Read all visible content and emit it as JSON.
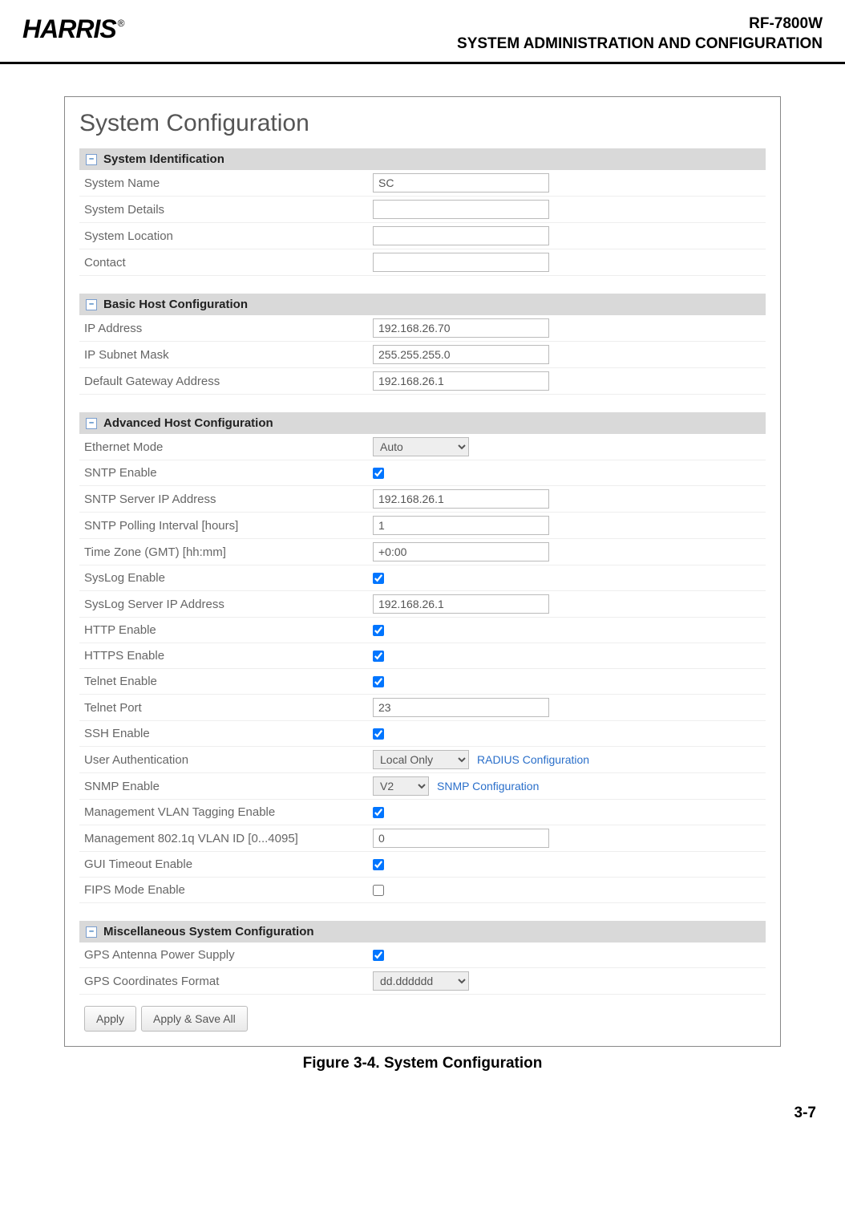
{
  "header": {
    "logo": "HARRIS",
    "reg": "®",
    "line1": "RF-7800W",
    "line2": "SYSTEM ADMINISTRATION AND CONFIGURATION"
  },
  "page_title": "System Configuration",
  "sections": {
    "sys_id": {
      "title": "System Identification",
      "collapse": "–",
      "rows": {
        "system_name": {
          "label": "System Name",
          "value": "SC"
        },
        "system_details": {
          "label": "System Details",
          "value": ""
        },
        "system_location": {
          "label": "System Location",
          "value": ""
        },
        "contact": {
          "label": "Contact",
          "value": ""
        }
      }
    },
    "basic_host": {
      "title": "Basic Host Configuration",
      "collapse": "–",
      "rows": {
        "ip_address": {
          "label": "IP Address",
          "value": "192.168.26.70"
        },
        "subnet_mask": {
          "label": "IP Subnet Mask",
          "value": "255.255.255.0"
        },
        "gateway": {
          "label": "Default Gateway Address",
          "value": "192.168.26.1"
        }
      }
    },
    "adv_host": {
      "title": "Advanced Host Configuration",
      "collapse": "–",
      "rows": {
        "eth_mode": {
          "label": "Ethernet Mode",
          "value": "Auto"
        },
        "sntp_enable": {
          "label": "SNTP Enable",
          "checked": true
        },
        "sntp_server": {
          "label": "SNTP Server IP Address",
          "value": "192.168.26.1"
        },
        "sntp_poll": {
          "label": "SNTP Polling Interval [hours]",
          "value": "1"
        },
        "timezone": {
          "label": "Time Zone (GMT)  [hh:mm]",
          "value": "+0:00"
        },
        "syslog_enable": {
          "label": "SysLog Enable",
          "checked": true
        },
        "syslog_server": {
          "label": "SysLog Server IP Address",
          "value": "192.168.26.1"
        },
        "http_enable": {
          "label": "HTTP Enable",
          "checked": true
        },
        "https_enable": {
          "label": "HTTPS Enable",
          "checked": true
        },
        "telnet_enable": {
          "label": "Telnet Enable",
          "checked": true
        },
        "telnet_port": {
          "label": "Telnet Port",
          "value": "23"
        },
        "ssh_enable": {
          "label": "SSH Enable",
          "checked": true
        },
        "user_auth": {
          "label": "User Authentication",
          "value": "Local Only",
          "link": "RADIUS Configuration"
        },
        "snmp_enable": {
          "label": "SNMP Enable",
          "value": "V2",
          "link": "SNMP Configuration"
        },
        "vlan_tag": {
          "label": "Management VLAN Tagging Enable",
          "checked": true
        },
        "vlan_id": {
          "label": "Management 802.1q VLAN ID [0...4095]",
          "value": "0"
        },
        "gui_timeout": {
          "label": "GUI Timeout Enable",
          "checked": true
        },
        "fips_mode": {
          "label": "FIPS Mode Enable",
          "checked": false
        }
      }
    },
    "misc": {
      "title": "Miscellaneous System Configuration",
      "collapse": "–",
      "rows": {
        "gps_power": {
          "label": "GPS Antenna Power Supply",
          "checked": true
        },
        "gps_format": {
          "label": "GPS Coordinates Format",
          "value": "dd.dddddd"
        }
      }
    }
  },
  "buttons": {
    "apply": "Apply",
    "apply_save": "Apply & Save All"
  },
  "caption": "Figure 3-4.  System Configuration",
  "page_num": "3-7"
}
